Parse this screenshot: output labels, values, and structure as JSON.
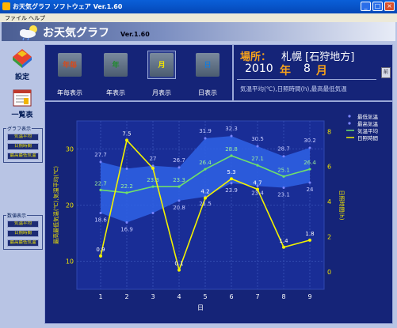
{
  "window": {
    "title": "お天気グラフ ソフトウェア Ver.1.60"
  },
  "menu": {
    "items": [
      "ファイル",
      "ヘルプ"
    ]
  },
  "header": {
    "app_name": "お天気グラフ",
    "version": "Ver.1.60"
  },
  "sidebar": {
    "settings_label": "設定",
    "list_label": "一覧表",
    "graph_group": {
      "title": "グラフ表示",
      "buttons": [
        "気温平均",
        "日照時間",
        "最高最低気温"
      ]
    },
    "table_group": {
      "title": "数値表示",
      "buttons": [
        "気温平均",
        "日照時間",
        "最高最低気温"
      ]
    }
  },
  "views": [
    {
      "icon_text": "年毎",
      "label": "年毎表示",
      "icon_color": "#d94a1a"
    },
    {
      "icon_text": "年",
      "label": "年表示",
      "icon_color": "#1e8c2a"
    },
    {
      "icon_text": "月",
      "label": "月表示",
      "icon_color": "#f2e600"
    },
    {
      "icon_text": "日",
      "label": "日表示",
      "icon_color": "#1a7ad6"
    }
  ],
  "info": {
    "location_label": "場所：",
    "location_value": "札幌 [石狩地方]",
    "year": "2010",
    "year_unit": "年",
    "month": "8",
    "month_unit": "月",
    "subtitle": "気温平均(℃),日照時間(h),最高最低気温",
    "next_button": "前"
  },
  "colors": {
    "panel": "#152478",
    "band": "#2f63e6",
    "avg_line": "#6fe06a",
    "sun_line": "#f2f200",
    "accent": "#f7a21b"
  },
  "chart_data": {
    "type": "line",
    "x": [
      1,
      2,
      3,
      4,
      5,
      6,
      7,
      8,
      9
    ],
    "xlabel": "日",
    "ylabel_left": "最高最低気温(℃),気温平均(℃)",
    "ylabel_right": "日照時間(h)",
    "ylim_left": [
      5,
      35
    ],
    "yticks_left": [
      10,
      20,
      30
    ],
    "ylim_right": [
      -1,
      8.6
    ],
    "yticks_right": [
      0,
      2,
      4,
      6,
      8
    ],
    "xticks": [
      "1",
      "2",
      "3",
      "4",
      "5",
      "6",
      "7",
      "8",
      "9"
    ],
    "grid": true,
    "legend_position": "top-right",
    "series": [
      {
        "name": "最低気温",
        "axis": "left",
        "values": [
          18.6,
          16.9,
          18.6,
          20.8,
          21.5,
          23.9,
          23.4,
          23.1,
          24.0
        ],
        "labels": [
          "18.6",
          "16.9",
          "",
          "20.8",
          "21.5",
          "23.9",
          "23.4",
          "23.1",
          "24"
        ]
      },
      {
        "name": "最高気温",
        "axis": "left",
        "values": [
          27.7,
          26.5,
          27,
          26.7,
          31.9,
          32.3,
          30.5,
          28.7,
          30.2
        ],
        "labels": [
          "27.7",
          "",
          "27",
          "26.7",
          "31.9",
          "32.3",
          "30.5",
          "28.7",
          "30.2"
        ]
      },
      {
        "name": "気温平均",
        "axis": "left",
        "values": [
          22.7,
          22.2,
          23.3,
          23.3,
          26.4,
          28.8,
          27.1,
          25.1,
          26.4
        ],
        "labels": [
          "22.7",
          "22.2",
          "23.3",
          "23.3",
          "26.4",
          "28.8",
          "27.1",
          "25.1",
          "26.4"
        ]
      },
      {
        "name": "日照時間",
        "axis": "right",
        "values": [
          0.9,
          7.5,
          5.9,
          0.1,
          4.2,
          5.3,
          4.7,
          1.4,
          1.8
        ],
        "labels": [
          "0.9",
          "7.5",
          "",
          "0.1",
          "4.2",
          "5.3",
          "4.7",
          "1.4",
          "1.8"
        ]
      }
    ]
  }
}
